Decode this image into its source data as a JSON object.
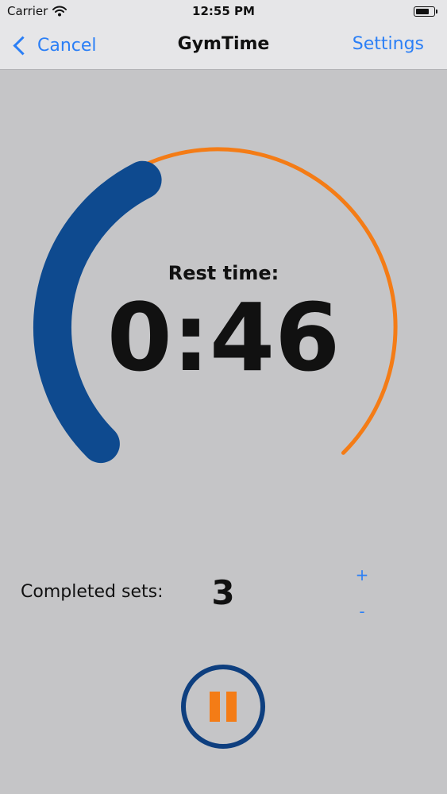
{
  "status_bar": {
    "carrier": "Carrier",
    "time": "12:55 PM",
    "wifi_icon": "wifi-icon",
    "battery_icon": "battery-icon",
    "battery_level": 0.8
  },
  "nav": {
    "back_label": "Cancel",
    "back_icon": "chevron-left-icon",
    "title": "GymTime",
    "settings_label": "Settings"
  },
  "timer": {
    "label": "Rest time:",
    "value": "0:46",
    "elapsed_fraction": 0.4,
    "colors": {
      "elapsed": "#0e4a8f",
      "remaining": "#f47c16"
    }
  },
  "sets": {
    "label": "Completed sets:",
    "value": "3",
    "plus_label": "+",
    "minus_label": "-"
  },
  "controls": {
    "pause_icon": "pause-icon",
    "colors": {
      "ring": "#0e3f7f",
      "icon": "#f47c16"
    }
  },
  "colors": {
    "accent": "#2b7ff6",
    "background": "#c5c5c7",
    "bar": "#e6e6e8"
  }
}
